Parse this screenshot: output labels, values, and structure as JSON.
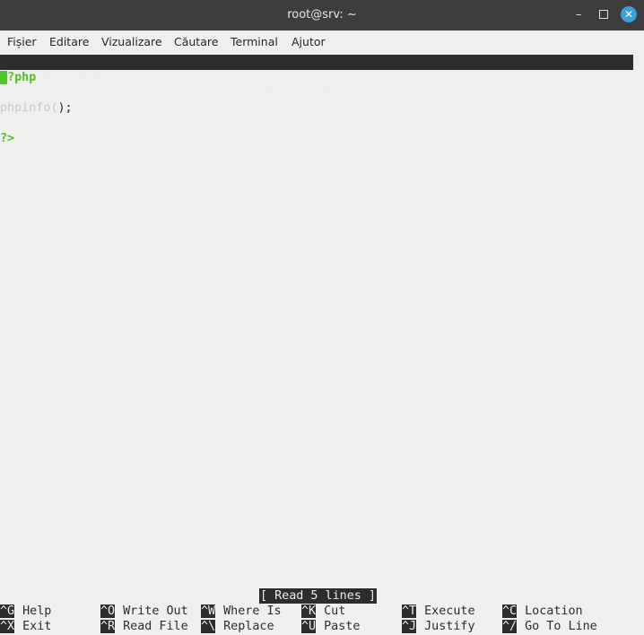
{
  "window": {
    "title": "root@srv: ~"
  },
  "menubar": [
    "Fișier",
    "Editare",
    "Vizualizare",
    "Căutare",
    "Terminal",
    "Ajutor"
  ],
  "nano": {
    "version": "GNU nano 6.2",
    "filename": "/var/www/html/info.php",
    "status": "[ Read 5 lines ]"
  },
  "editor": {
    "line1_cursor": "<",
    "line1_rest": "?php",
    "line3_fn": "phpinfo",
    "line3_paren_open": "(",
    "line3_paren_close": ");",
    "line5": "?>"
  },
  "shortcuts": [
    [
      {
        "key": "^G",
        "label": "Help"
      },
      {
        "key": "^O",
        "label": "Write Out"
      },
      {
        "key": "^W",
        "label": "Where Is"
      },
      {
        "key": "^K",
        "label": "Cut"
      },
      {
        "key": "^T",
        "label": "Execute"
      },
      {
        "key": "^C",
        "label": "Location"
      }
    ],
    [
      {
        "key": "^X",
        "label": "Exit"
      },
      {
        "key": "^R",
        "label": "Read File"
      },
      {
        "key": "^\\",
        "label": "Replace"
      },
      {
        "key": "^U",
        "label": "Paste"
      },
      {
        "key": "^J",
        "label": "Justify"
      },
      {
        "key": "^/",
        "label": "Go To Line"
      }
    ]
  ],
  "colors": {
    "titlebar": "#3d3d3d",
    "terminal_bg": "#efefed",
    "nano_bar": "#2d2d2d",
    "php_tag": "#53c41f",
    "close_button": "#3aa0d8"
  }
}
